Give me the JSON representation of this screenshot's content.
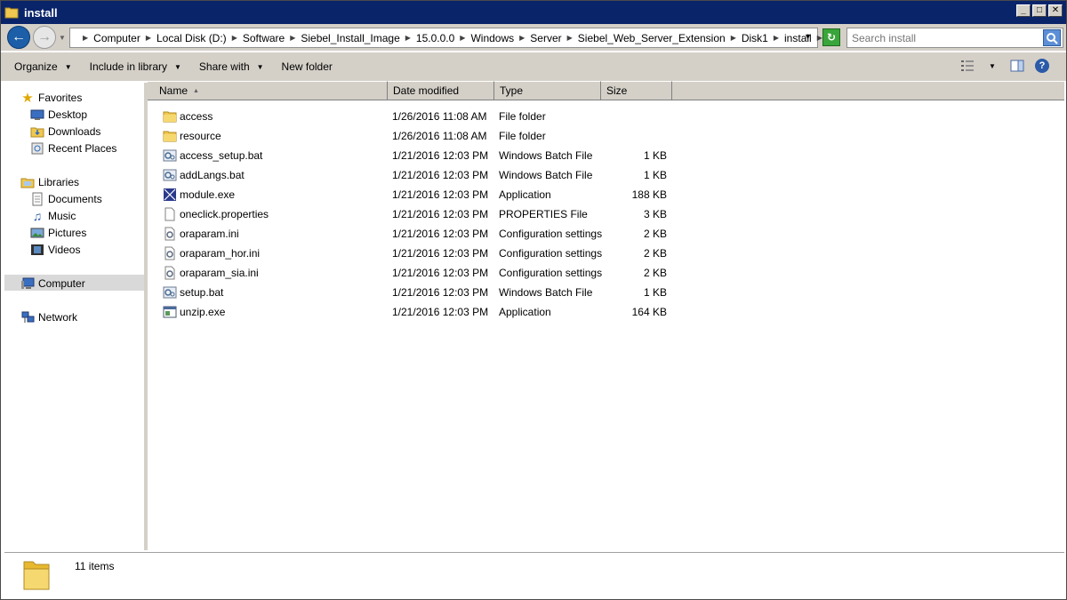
{
  "window": {
    "title": "install",
    "minimize_glyph": "_",
    "maximize_glyph": "□",
    "close_glyph": "✕"
  },
  "address": {
    "crumbs": [
      "Computer",
      "Local Disk (D:)",
      "Software",
      "Siebel_Install_Image",
      "15.0.0.0",
      "Windows",
      "Server",
      "Siebel_Web_Server_Extension",
      "Disk1",
      "install"
    ],
    "search_placeholder": "Search install"
  },
  "toolbar": {
    "organize": "Organize",
    "include_in_library": "Include in library",
    "share_with": "Share with",
    "new_folder": "New folder"
  },
  "nav": {
    "favorites": {
      "label": "Favorites",
      "items": [
        "Desktop",
        "Downloads",
        "Recent Places"
      ]
    },
    "libraries": {
      "label": "Libraries",
      "items": [
        "Documents",
        "Music",
        "Pictures",
        "Videos"
      ]
    },
    "computer": "Computer",
    "network": "Network"
  },
  "columns": {
    "name": "Name",
    "date_modified": "Date modified",
    "type": "Type",
    "size": "Size"
  },
  "files": [
    {
      "name": "access",
      "date": "1/26/2016 11:08 AM",
      "type": "File folder",
      "size": "",
      "icon": "folder-icon"
    },
    {
      "name": "resource",
      "date": "1/26/2016 11:08 AM",
      "type": "File folder",
      "size": "",
      "icon": "folder-icon"
    },
    {
      "name": "access_setup.bat",
      "date": "1/21/2016 12:03 PM",
      "type": "Windows Batch File",
      "size": "1 KB",
      "icon": "batch-file-icon"
    },
    {
      "name": "addLangs.bat",
      "date": "1/21/2016 12:03 PM",
      "type": "Windows Batch File",
      "size": "1 KB",
      "icon": "batch-file-icon"
    },
    {
      "name": "module.exe",
      "date": "1/21/2016 12:03 PM",
      "type": "Application",
      "size": "188 KB",
      "icon": "module-exe-icon"
    },
    {
      "name": "oneclick.properties",
      "date": "1/21/2016 12:03 PM",
      "type": "PROPERTIES File",
      "size": "3 KB",
      "icon": "blank-file-icon"
    },
    {
      "name": "oraparam.ini",
      "date": "1/21/2016 12:03 PM",
      "type": "Configuration settings",
      "size": "2 KB",
      "icon": "settings-file-icon"
    },
    {
      "name": "oraparam_hor.ini",
      "date": "1/21/2016 12:03 PM",
      "type": "Configuration settings",
      "size": "2 KB",
      "icon": "settings-file-icon"
    },
    {
      "name": "oraparam_sia.ini",
      "date": "1/21/2016 12:03 PM",
      "type": "Configuration settings",
      "size": "2 KB",
      "icon": "settings-file-icon"
    },
    {
      "name": "setup.bat",
      "date": "1/21/2016 12:03 PM",
      "type": "Windows Batch File",
      "size": "1 KB",
      "icon": "batch-file-icon"
    },
    {
      "name": "unzip.exe",
      "date": "1/21/2016 12:03 PM",
      "type": "Application",
      "size": "164 KB",
      "icon": "application-icon"
    }
  ],
  "status": {
    "item_count": "11 items"
  },
  "colors": {
    "titlebar": "#0a246a",
    "chrome": "#d4d0c8",
    "folder": "#f0c850",
    "nav_selected": "#d9d9d9"
  }
}
